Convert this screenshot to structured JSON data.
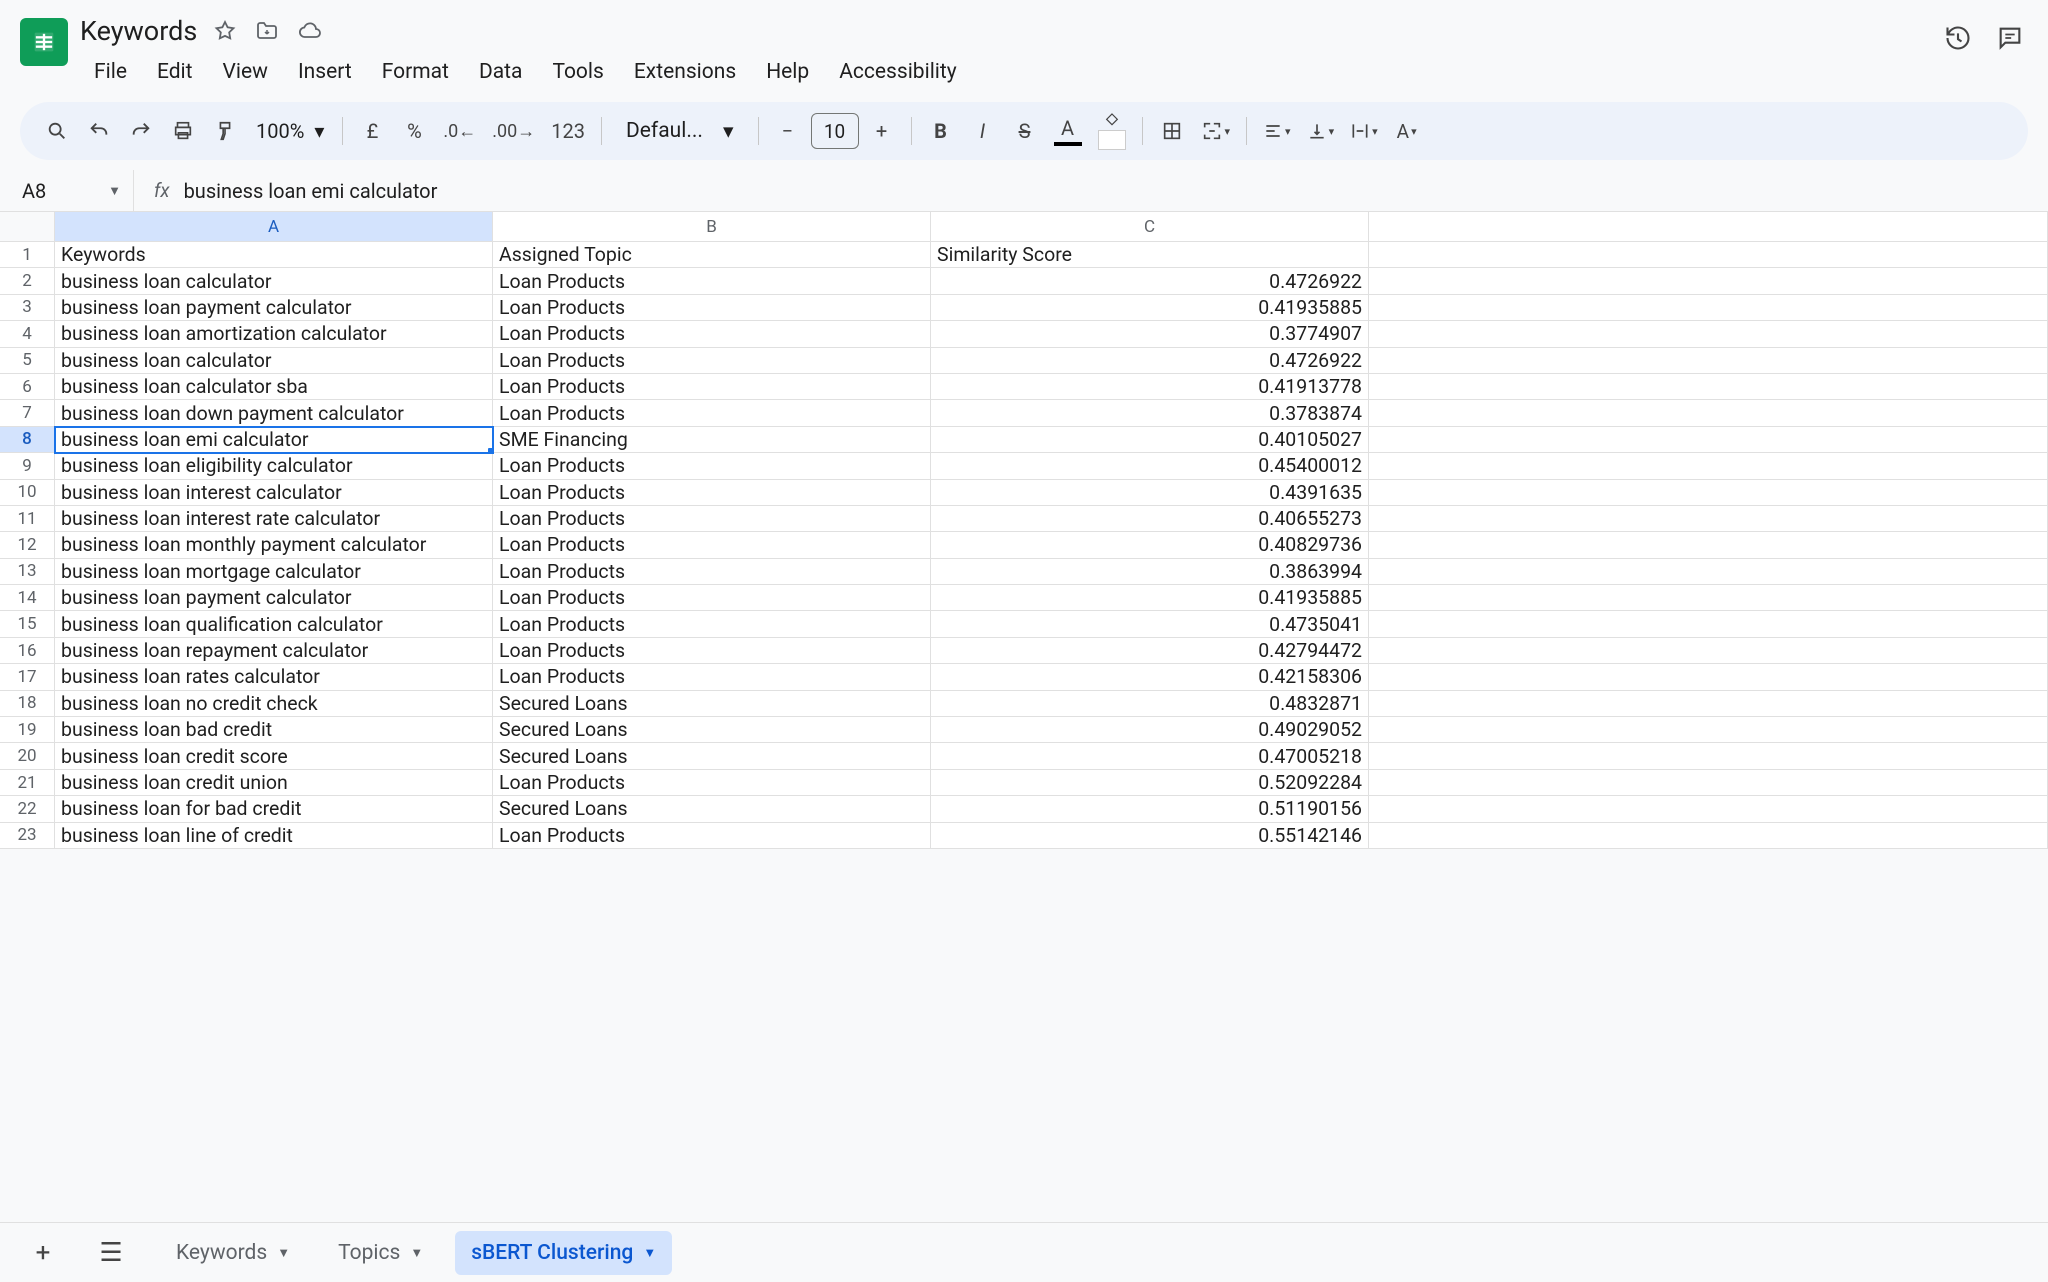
{
  "doc_title": "Keywords",
  "menus": [
    "File",
    "Edit",
    "View",
    "Insert",
    "Format",
    "Data",
    "Tools",
    "Extensions",
    "Help",
    "Accessibility"
  ],
  "toolbar": {
    "zoom": "100%",
    "number_format": "123",
    "font": "Defaul...",
    "font_size": "10",
    "currency_symbol": "£",
    "percent_symbol": "%"
  },
  "name_box": "A8",
  "formula_bar": "business loan emi calculator",
  "columns": [
    "A",
    "B",
    "C"
  ],
  "headers": {
    "A": "Keywords",
    "B": "Assigned Topic",
    "C": "Similarity Score"
  },
  "selected_cell": {
    "row": 8,
    "col": "A"
  },
  "rows": [
    {
      "A": "business loan calculator",
      "B": "Loan Products",
      "C": "0.4726922"
    },
    {
      "A": "business loan payment calculator",
      "B": "Loan Products",
      "C": "0.41935885"
    },
    {
      "A": "business loan amortization calculator",
      "B": "Loan Products",
      "C": "0.3774907"
    },
    {
      "A": "business loan calculator",
      "B": "Loan Products",
      "C": "0.4726922"
    },
    {
      "A": "business loan calculator sba",
      "B": "Loan Products",
      "C": "0.41913778"
    },
    {
      "A": "business loan down payment calculator",
      "B": "Loan Products",
      "C": "0.3783874"
    },
    {
      "A": "business loan emi calculator",
      "B": "SME Financing",
      "C": "0.40105027"
    },
    {
      "A": "business loan eligibility calculator",
      "B": "Loan Products",
      "C": "0.45400012"
    },
    {
      "A": "business loan interest calculator",
      "B": "Loan Products",
      "C": "0.4391635"
    },
    {
      "A": "business loan interest rate calculator",
      "B": "Loan Products",
      "C": "0.40655273"
    },
    {
      "A": "business loan monthly payment calculator",
      "B": "Loan Products",
      "C": "0.40829736"
    },
    {
      "A": "business loan mortgage calculator",
      "B": "Loan Products",
      "C": "0.3863994"
    },
    {
      "A": "business loan payment calculator",
      "B": "Loan Products",
      "C": "0.41935885"
    },
    {
      "A": "business loan qualification calculator",
      "B": "Loan Products",
      "C": "0.4735041"
    },
    {
      "A": "business loan repayment calculator",
      "B": "Loan Products",
      "C": "0.42794472"
    },
    {
      "A": "business loan rates calculator",
      "B": "Loan Products",
      "C": "0.42158306"
    },
    {
      "A": "business loan no credit check",
      "B": "Secured Loans",
      "C": "0.4832871"
    },
    {
      "A": "business loan bad credit",
      "B": "Secured Loans",
      "C": "0.49029052"
    },
    {
      "A": "business loan credit score",
      "B": "Secured Loans",
      "C": "0.47005218"
    },
    {
      "A": "business loan credit union",
      "B": "Loan Products",
      "C": "0.52092284"
    },
    {
      "A": "business loan for bad credit",
      "B": "Secured Loans",
      "C": "0.51190156"
    },
    {
      "A": "business loan line of credit",
      "B": "Loan Products",
      "C": "0.55142146"
    }
  ],
  "sheet_tabs": [
    {
      "name": "Keywords",
      "active": false
    },
    {
      "name": "Topics",
      "active": false
    },
    {
      "name": "sBERT Clustering",
      "active": true
    }
  ]
}
